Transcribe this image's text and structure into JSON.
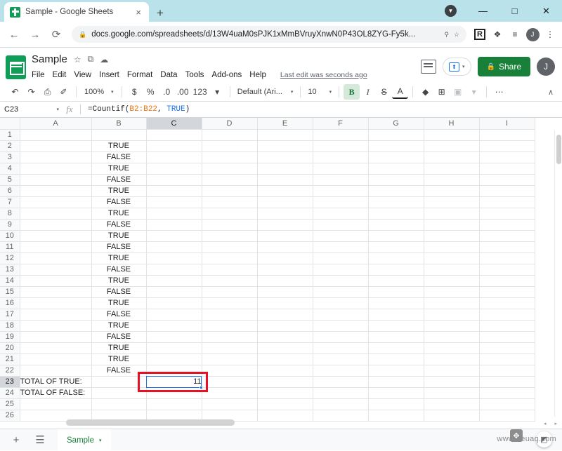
{
  "browser": {
    "tab_title": "Sample - Google Sheets",
    "tab_close": "×",
    "new_tab": "+",
    "back": "←",
    "forward": "→",
    "reload": "⟳",
    "url": "docs.google.com/spreadsheets/d/13W4uaM0sPJK1xMmBVruyXnwN0P43OL8ZYG-Fy5k...",
    "lock_icon": "🔒",
    "zoom_icon": "⚲",
    "bookmark_icon": "☆",
    "ext_r_label": "R",
    "ext_puzzle": "❖",
    "ext_list": "≡",
    "profile_initial": "J",
    "menu_dots": "⋮",
    "minimize": "—",
    "maximize": "□",
    "close": "✕",
    "tab_badge": "▼"
  },
  "sheets_header": {
    "doc_title": "Sample",
    "star_icon": "☆",
    "move_icon": "⧉",
    "cloud_icon": "☁",
    "menus": [
      "File",
      "Edit",
      "View",
      "Insert",
      "Format",
      "Data",
      "Tools",
      "Add-ons",
      "Help"
    ],
    "last_edit": "Last edit was seconds ago",
    "comment_icon": "comment-icon",
    "present_icon": "⬆",
    "present_caret": "▾",
    "share_lock": "🔒",
    "share_label": "Share",
    "avatar_initial": "J"
  },
  "toolbar": {
    "undo": "↶",
    "redo": "↷",
    "print": "⎙",
    "paint": "✐",
    "zoom_value": "100%",
    "zoom_caret": "▾",
    "currency": "$",
    "percent": "%",
    "dec_decrease": ".0",
    "dec_increase": ".00",
    "more_formats": "123",
    "format_caret": "▾",
    "font_name": "Default (Ari...",
    "font_caret": "▾",
    "font_size": "10",
    "size_caret": "▾",
    "bold": "B",
    "italic": "I",
    "strikethrough": "S",
    "text_color": "A",
    "fill_color": "◆",
    "borders": "⊞",
    "merge": "▣",
    "merge_caret": "▾",
    "more": "⋯",
    "collapse": "∧"
  },
  "formula_bar": {
    "name_box": "C23",
    "name_caret": "▾",
    "fx": "fx",
    "formula_prefix": "=Countif(",
    "formula_range": "B2:B22",
    "formula_comma": ", ",
    "formula_arg": "TRUE",
    "formula_suffix": ")"
  },
  "grid": {
    "columns": [
      "A",
      "B",
      "C",
      "D",
      "E",
      "F",
      "G",
      "H",
      "I"
    ],
    "selected_column": "C",
    "selected_row": 23,
    "rows": [
      {
        "n": 1,
        "a": "",
        "b": "",
        "c": ""
      },
      {
        "n": 2,
        "a": "",
        "b": "TRUE",
        "c": ""
      },
      {
        "n": 3,
        "a": "",
        "b": "FALSE",
        "c": ""
      },
      {
        "n": 4,
        "a": "",
        "b": "TRUE",
        "c": ""
      },
      {
        "n": 5,
        "a": "",
        "b": "FALSE",
        "c": ""
      },
      {
        "n": 6,
        "a": "",
        "b": "TRUE",
        "c": ""
      },
      {
        "n": 7,
        "a": "",
        "b": "FALSE",
        "c": ""
      },
      {
        "n": 8,
        "a": "",
        "b": "TRUE",
        "c": ""
      },
      {
        "n": 9,
        "a": "",
        "b": "FALSE",
        "c": ""
      },
      {
        "n": 10,
        "a": "",
        "b": "TRUE",
        "c": ""
      },
      {
        "n": 11,
        "a": "",
        "b": "FALSE",
        "c": ""
      },
      {
        "n": 12,
        "a": "",
        "b": "TRUE",
        "c": ""
      },
      {
        "n": 13,
        "a": "",
        "b": "FALSE",
        "c": ""
      },
      {
        "n": 14,
        "a": "",
        "b": "TRUE",
        "c": ""
      },
      {
        "n": 15,
        "a": "",
        "b": "FALSE",
        "c": ""
      },
      {
        "n": 16,
        "a": "",
        "b": "TRUE",
        "c": ""
      },
      {
        "n": 17,
        "a": "",
        "b": "FALSE",
        "c": ""
      },
      {
        "n": 18,
        "a": "",
        "b": "TRUE",
        "c": ""
      },
      {
        "n": 19,
        "a": "",
        "b": "FALSE",
        "c": ""
      },
      {
        "n": 20,
        "a": "",
        "b": "TRUE",
        "c": ""
      },
      {
        "n": 21,
        "a": "",
        "b": "TRUE",
        "c": ""
      },
      {
        "n": 22,
        "a": "",
        "b": "FALSE",
        "c": ""
      },
      {
        "n": 23,
        "a": "TOTAL OF TRUE:",
        "b": "",
        "c": "11"
      },
      {
        "n": 24,
        "a": "TOTAL OF FALSE:",
        "b": "",
        "c": ""
      },
      {
        "n": 25,
        "a": "",
        "b": "",
        "c": ""
      },
      {
        "n": 26,
        "a": "",
        "b": "",
        "c": ""
      }
    ],
    "selected_cell_value": "11"
  },
  "sheet_bar": {
    "add_sheet": "+",
    "all_sheets": "☰",
    "tab_name": "Sample",
    "tab_caret": "▾",
    "explore": "◩",
    "scroll_arrows": "◂ ▸"
  },
  "watermark": {
    "text": "www.deuaq.com",
    "badge": "✥"
  },
  "colors": {
    "sheets_green": "#0f9d58",
    "share_green": "#188038",
    "selection_blue": "#1a73e8",
    "annotation_red": "#e81123",
    "titlebar_blue": "#b9e2ea",
    "formula_orange": "#e8710a"
  }
}
